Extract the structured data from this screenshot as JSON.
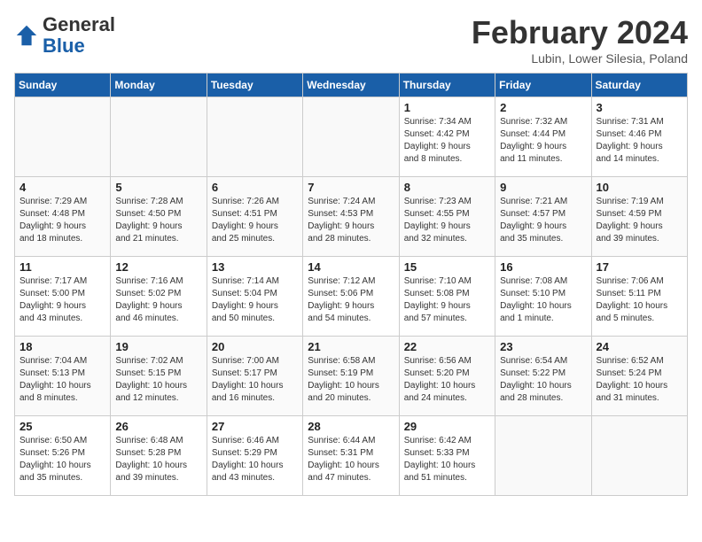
{
  "header": {
    "logo_general": "General",
    "logo_blue": "Blue",
    "month_year": "February 2024",
    "location": "Lubin, Lower Silesia, Poland"
  },
  "weekdays": [
    "Sunday",
    "Monday",
    "Tuesday",
    "Wednesday",
    "Thursday",
    "Friday",
    "Saturday"
  ],
  "weeks": [
    [
      {
        "day": "",
        "info": ""
      },
      {
        "day": "",
        "info": ""
      },
      {
        "day": "",
        "info": ""
      },
      {
        "day": "",
        "info": ""
      },
      {
        "day": "1",
        "info": "Sunrise: 7:34 AM\nSunset: 4:42 PM\nDaylight: 9 hours\nand 8 minutes."
      },
      {
        "day": "2",
        "info": "Sunrise: 7:32 AM\nSunset: 4:44 PM\nDaylight: 9 hours\nand 11 minutes."
      },
      {
        "day": "3",
        "info": "Sunrise: 7:31 AM\nSunset: 4:46 PM\nDaylight: 9 hours\nand 14 minutes."
      }
    ],
    [
      {
        "day": "4",
        "info": "Sunrise: 7:29 AM\nSunset: 4:48 PM\nDaylight: 9 hours\nand 18 minutes."
      },
      {
        "day": "5",
        "info": "Sunrise: 7:28 AM\nSunset: 4:50 PM\nDaylight: 9 hours\nand 21 minutes."
      },
      {
        "day": "6",
        "info": "Sunrise: 7:26 AM\nSunset: 4:51 PM\nDaylight: 9 hours\nand 25 minutes."
      },
      {
        "day": "7",
        "info": "Sunrise: 7:24 AM\nSunset: 4:53 PM\nDaylight: 9 hours\nand 28 minutes."
      },
      {
        "day": "8",
        "info": "Sunrise: 7:23 AM\nSunset: 4:55 PM\nDaylight: 9 hours\nand 32 minutes."
      },
      {
        "day": "9",
        "info": "Sunrise: 7:21 AM\nSunset: 4:57 PM\nDaylight: 9 hours\nand 35 minutes."
      },
      {
        "day": "10",
        "info": "Sunrise: 7:19 AM\nSunset: 4:59 PM\nDaylight: 9 hours\nand 39 minutes."
      }
    ],
    [
      {
        "day": "11",
        "info": "Sunrise: 7:17 AM\nSunset: 5:00 PM\nDaylight: 9 hours\nand 43 minutes."
      },
      {
        "day": "12",
        "info": "Sunrise: 7:16 AM\nSunset: 5:02 PM\nDaylight: 9 hours\nand 46 minutes."
      },
      {
        "day": "13",
        "info": "Sunrise: 7:14 AM\nSunset: 5:04 PM\nDaylight: 9 hours\nand 50 minutes."
      },
      {
        "day": "14",
        "info": "Sunrise: 7:12 AM\nSunset: 5:06 PM\nDaylight: 9 hours\nand 54 minutes."
      },
      {
        "day": "15",
        "info": "Sunrise: 7:10 AM\nSunset: 5:08 PM\nDaylight: 9 hours\nand 57 minutes."
      },
      {
        "day": "16",
        "info": "Sunrise: 7:08 AM\nSunset: 5:10 PM\nDaylight: 10 hours\nand 1 minute."
      },
      {
        "day": "17",
        "info": "Sunrise: 7:06 AM\nSunset: 5:11 PM\nDaylight: 10 hours\nand 5 minutes."
      }
    ],
    [
      {
        "day": "18",
        "info": "Sunrise: 7:04 AM\nSunset: 5:13 PM\nDaylight: 10 hours\nand 8 minutes."
      },
      {
        "day": "19",
        "info": "Sunrise: 7:02 AM\nSunset: 5:15 PM\nDaylight: 10 hours\nand 12 minutes."
      },
      {
        "day": "20",
        "info": "Sunrise: 7:00 AM\nSunset: 5:17 PM\nDaylight: 10 hours\nand 16 minutes."
      },
      {
        "day": "21",
        "info": "Sunrise: 6:58 AM\nSunset: 5:19 PM\nDaylight: 10 hours\nand 20 minutes."
      },
      {
        "day": "22",
        "info": "Sunrise: 6:56 AM\nSunset: 5:20 PM\nDaylight: 10 hours\nand 24 minutes."
      },
      {
        "day": "23",
        "info": "Sunrise: 6:54 AM\nSunset: 5:22 PM\nDaylight: 10 hours\nand 28 minutes."
      },
      {
        "day": "24",
        "info": "Sunrise: 6:52 AM\nSunset: 5:24 PM\nDaylight: 10 hours\nand 31 minutes."
      }
    ],
    [
      {
        "day": "25",
        "info": "Sunrise: 6:50 AM\nSunset: 5:26 PM\nDaylight: 10 hours\nand 35 minutes."
      },
      {
        "day": "26",
        "info": "Sunrise: 6:48 AM\nSunset: 5:28 PM\nDaylight: 10 hours\nand 39 minutes."
      },
      {
        "day": "27",
        "info": "Sunrise: 6:46 AM\nSunset: 5:29 PM\nDaylight: 10 hours\nand 43 minutes."
      },
      {
        "day": "28",
        "info": "Sunrise: 6:44 AM\nSunset: 5:31 PM\nDaylight: 10 hours\nand 47 minutes."
      },
      {
        "day": "29",
        "info": "Sunrise: 6:42 AM\nSunset: 5:33 PM\nDaylight: 10 hours\nand 51 minutes."
      },
      {
        "day": "",
        "info": ""
      },
      {
        "day": "",
        "info": ""
      }
    ]
  ]
}
